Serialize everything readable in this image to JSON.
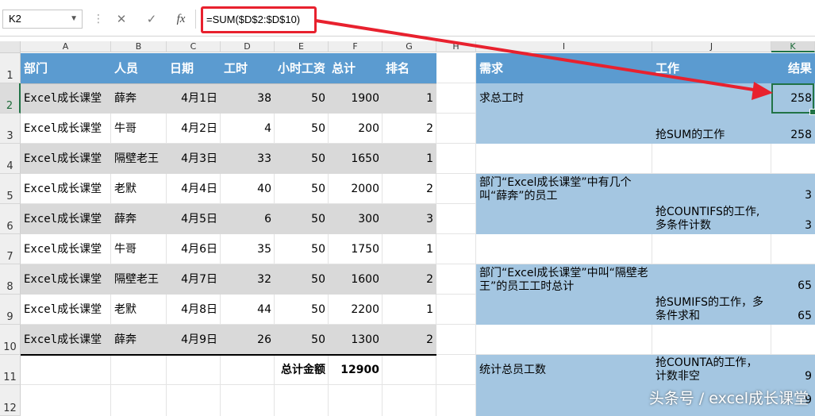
{
  "formula_bar": {
    "name_box": "K2",
    "cancel_icon": "✕",
    "enter_icon": "✓",
    "fx_label": "fx",
    "formula": "=SUM($D$2:$D$10)"
  },
  "columns": [
    "A",
    "B",
    "C",
    "D",
    "E",
    "F",
    "G",
    "H",
    "I",
    "J",
    "K"
  ],
  "rows": [
    "1",
    "2",
    "3",
    "4",
    "5",
    "6",
    "7",
    "8",
    "9",
    "10",
    "11",
    "12"
  ],
  "selected_cell": "K2",
  "table": {
    "headers": [
      "部门",
      "人员",
      "日期",
      "工时",
      "小时工资",
      "总计",
      "排名"
    ],
    "rows": [
      [
        "Excel成长课堂",
        "薛奔",
        "4月1日",
        "38",
        "50",
        "1900",
        "1"
      ],
      [
        "Excel成长课堂",
        "牛哥",
        "4月2日",
        "4",
        "50",
        "200",
        "2"
      ],
      [
        "Excel成长课堂",
        "隔壁老王",
        "4月3日",
        "33",
        "50",
        "1650",
        "1"
      ],
      [
        "Excel成长课堂",
        "老默",
        "4月4日",
        "40",
        "50",
        "2000",
        "2"
      ],
      [
        "Excel成长课堂",
        "薛奔",
        "4月5日",
        "6",
        "50",
        "300",
        "3"
      ],
      [
        "Excel成长课堂",
        "牛哥",
        "4月6日",
        "35",
        "50",
        "1750",
        "1"
      ],
      [
        "Excel成长课堂",
        "隔壁老王",
        "4月7日",
        "32",
        "50",
        "1600",
        "2"
      ],
      [
        "Excel成长课堂",
        "老默",
        "4月8日",
        "44",
        "50",
        "2200",
        "1"
      ],
      [
        "Excel成长课堂",
        "薛奔",
        "4月9日",
        "26",
        "50",
        "1300",
        "2"
      ]
    ],
    "total_label": "总计金额",
    "total_value": "12900"
  },
  "right_table": {
    "headers": [
      "需求",
      "工作",
      "结果"
    ],
    "r2_need": "求总工时",
    "r2_result": "258",
    "r3_work": "抢SUM的工作",
    "r3_result": "258",
    "r5_need": "部门“Excel成长课堂”中有几个叫“薛奔”的员工",
    "r5_result": "3",
    "r6_work": "抢COUNTIFS的工作,多条件计数",
    "r6_result": "3",
    "r8_need": "部门“Excel成长课堂”中叫“隔壁老王”的员工工时总计",
    "r8_result": "65",
    "r9_work": "抢SUMIFS的工作，多条件求和",
    "r9_result": "65",
    "r11_need": "统计总员工数",
    "r11_work": "抢COUNTA的工作，计数非空",
    "r11_result": "9",
    "r12_result": "9"
  },
  "watermark": "头条号 / excel成长课堂",
  "colors": {
    "header_blue": "#5b9bd0",
    "light_blue": "#a4c6e1",
    "band_gray": "#d9d9d9",
    "arrow_red": "#e8212e",
    "excel_green": "#217346"
  }
}
